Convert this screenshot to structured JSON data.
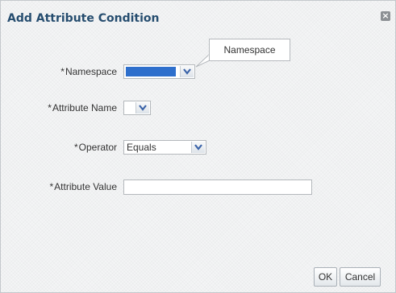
{
  "dialog": {
    "title": "Add Attribute Condition",
    "close_glyph": "×"
  },
  "tooltip": {
    "text": "Namespace"
  },
  "fields": {
    "namespace": {
      "required_mark": "*",
      "label": "Namespace",
      "value": ""
    },
    "attribute_name": {
      "required_mark": "*",
      "label": "Attribute Name",
      "value": ""
    },
    "operator": {
      "required_mark": "*",
      "label": "Operator",
      "value": "Equals"
    },
    "attribute_value": {
      "required_mark": "*",
      "label": "Attribute Value",
      "value": ""
    }
  },
  "buttons": {
    "ok": "OK",
    "cancel": "Cancel"
  },
  "colors": {
    "title": "#264d6f",
    "selection": "#2e6fcc",
    "arrow": "#3b63a8"
  }
}
